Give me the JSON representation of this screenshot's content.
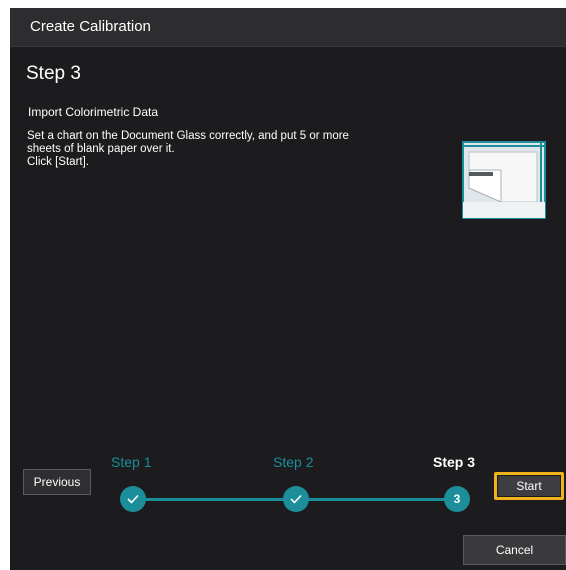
{
  "dialog": {
    "title": "Create Calibration",
    "step_heading": "Step 3",
    "subheading": "Import Colorimetric Data",
    "instructions": [
      "Set a chart on the Document Glass correctly, and put 5 or more",
      "sheets of blank paper over it.",
      "Click [Start]."
    ]
  },
  "stepper": {
    "steps": [
      {
        "label": "Step 1",
        "status": "completed",
        "icon": "check-icon"
      },
      {
        "label": "Step 2",
        "status": "completed",
        "icon": "check-icon"
      },
      {
        "label": "Step 3",
        "status": "current",
        "number": "3"
      }
    ],
    "accent_color": "#1b8e99"
  },
  "buttons": {
    "previous": "Previous",
    "start": "Start",
    "cancel": "Cancel"
  },
  "colors": {
    "background": "#1c1c1e",
    "titlebar": "#2d2d30",
    "highlight": "#f0b41a"
  }
}
